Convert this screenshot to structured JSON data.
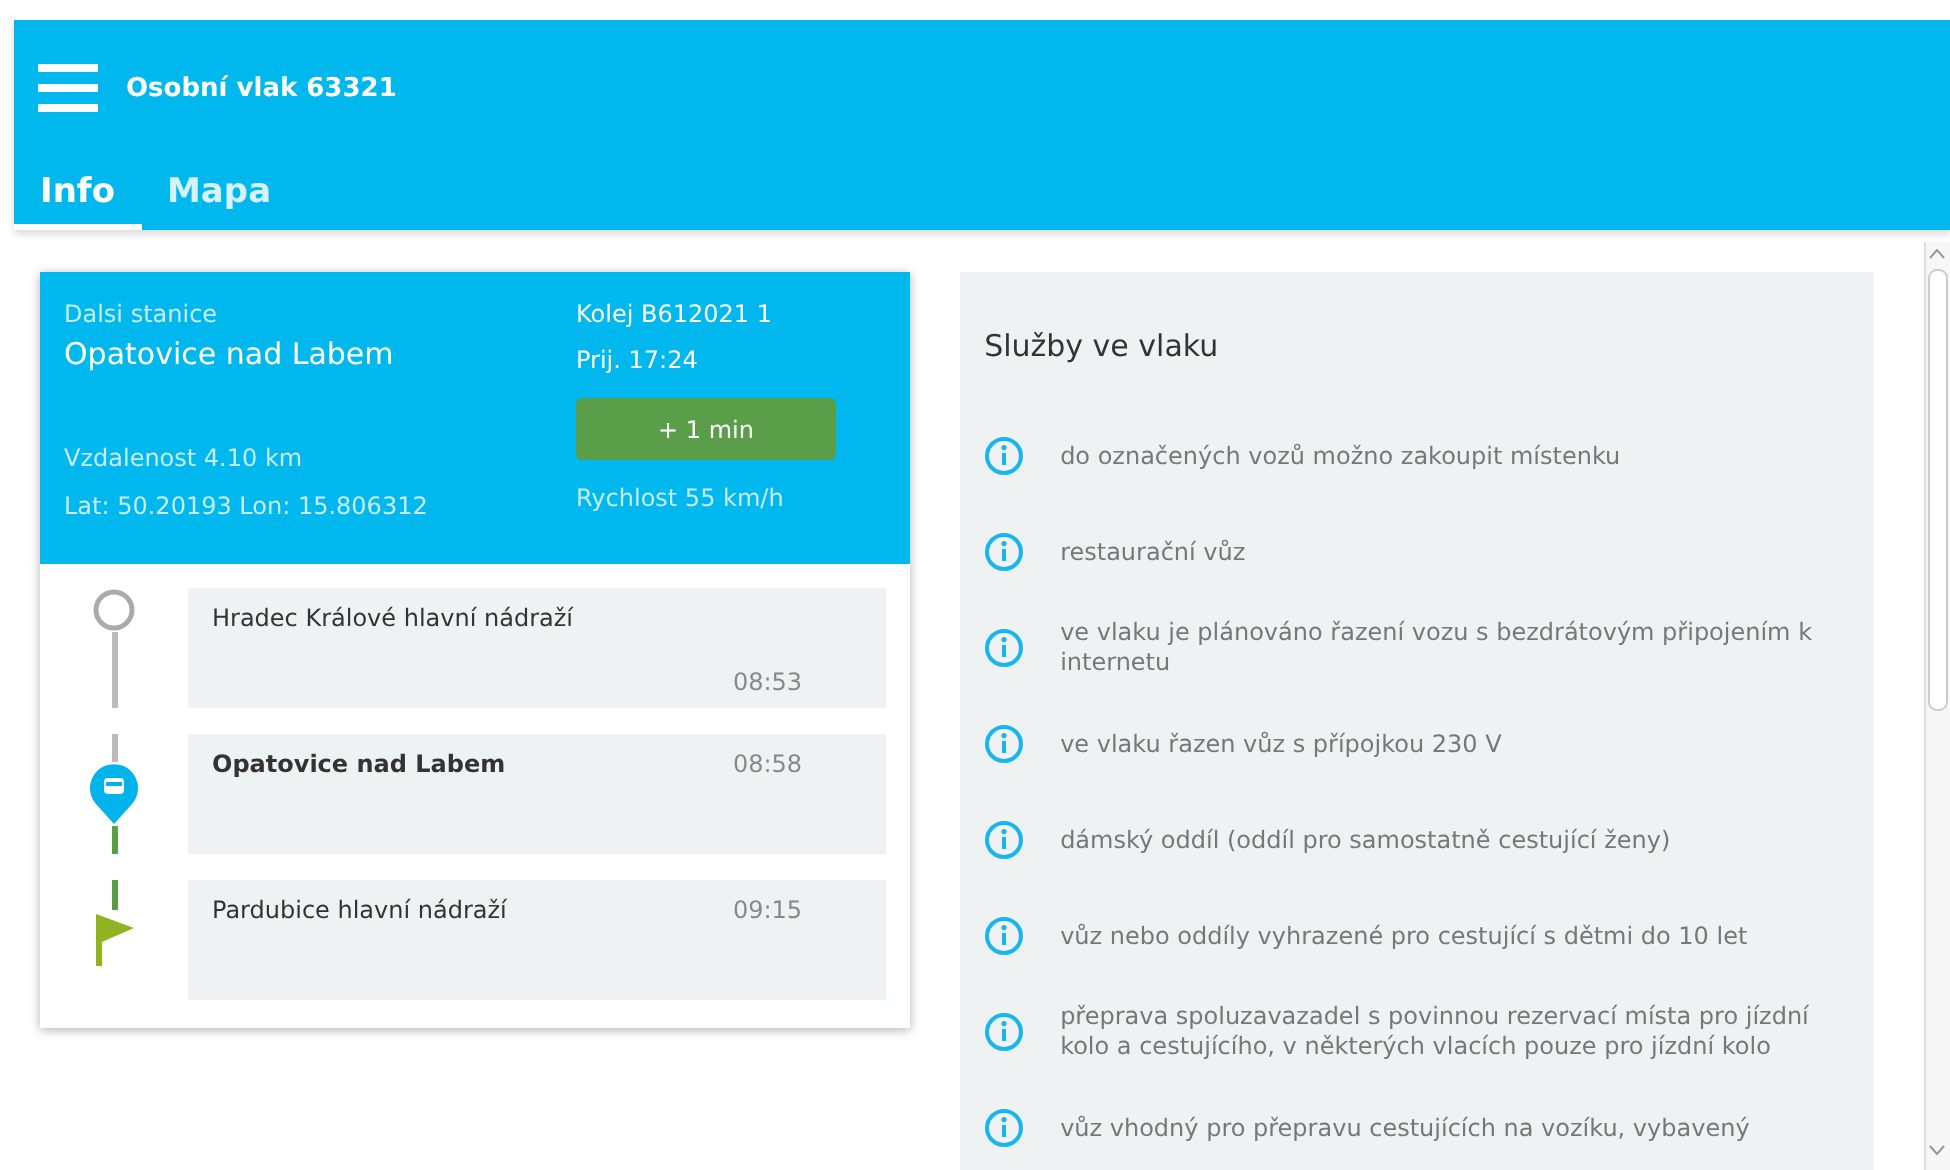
{
  "app_bar": {
    "title": "Osobní vlak 63321"
  },
  "tabs": [
    {
      "label": "Info",
      "selected": true
    },
    {
      "label": "Mapa",
      "selected": false
    }
  ],
  "next_station": {
    "caption": "Dalsi stanice",
    "name": "Opatovice nad Labem",
    "track": "Kolej B612021  1",
    "arrival": "Prij. 17:24",
    "delay": "+ 1 min",
    "distance": "Vzdalenost 4.10 km",
    "position": "Lat: 50.20193 Lon: 15.806312",
    "speed": "Rychlost 55 km/h"
  },
  "stops": [
    {
      "kind": "start",
      "name": "Hradec Králové hlavní nádraží",
      "time": "08:53"
    },
    {
      "kind": "current",
      "name": "Opatovice nad Labem",
      "time": "08:58"
    },
    {
      "kind": "end",
      "name": "Pardubice hlavní nádraží",
      "time": "09:15"
    }
  ],
  "services": {
    "title": "Služby ve vlaku",
    "items": [
      "do označených vozů možno zakoupit místenku",
      "restaurační vůz",
      "ve vlaku je plánováno řazení vozu s bezdrátovým připojením k internetu",
      "ve vlaku řazen vůz s přípojkou 230 V",
      "dámský oddíl (oddíl pro samostatně cestující ženy)",
      "vůz nebo oddíly vyhrazené pro cestující s dětmi do 10 let",
      "přeprava spoluzavazadel s povinnou rezervací místa pro jízdní kolo a cestujícího, v některých vlacích pouze pro jízdní kolo",
      "vůz vhodný pro přepravu cestujících na vozíku, vybavený"
    ]
  }
}
